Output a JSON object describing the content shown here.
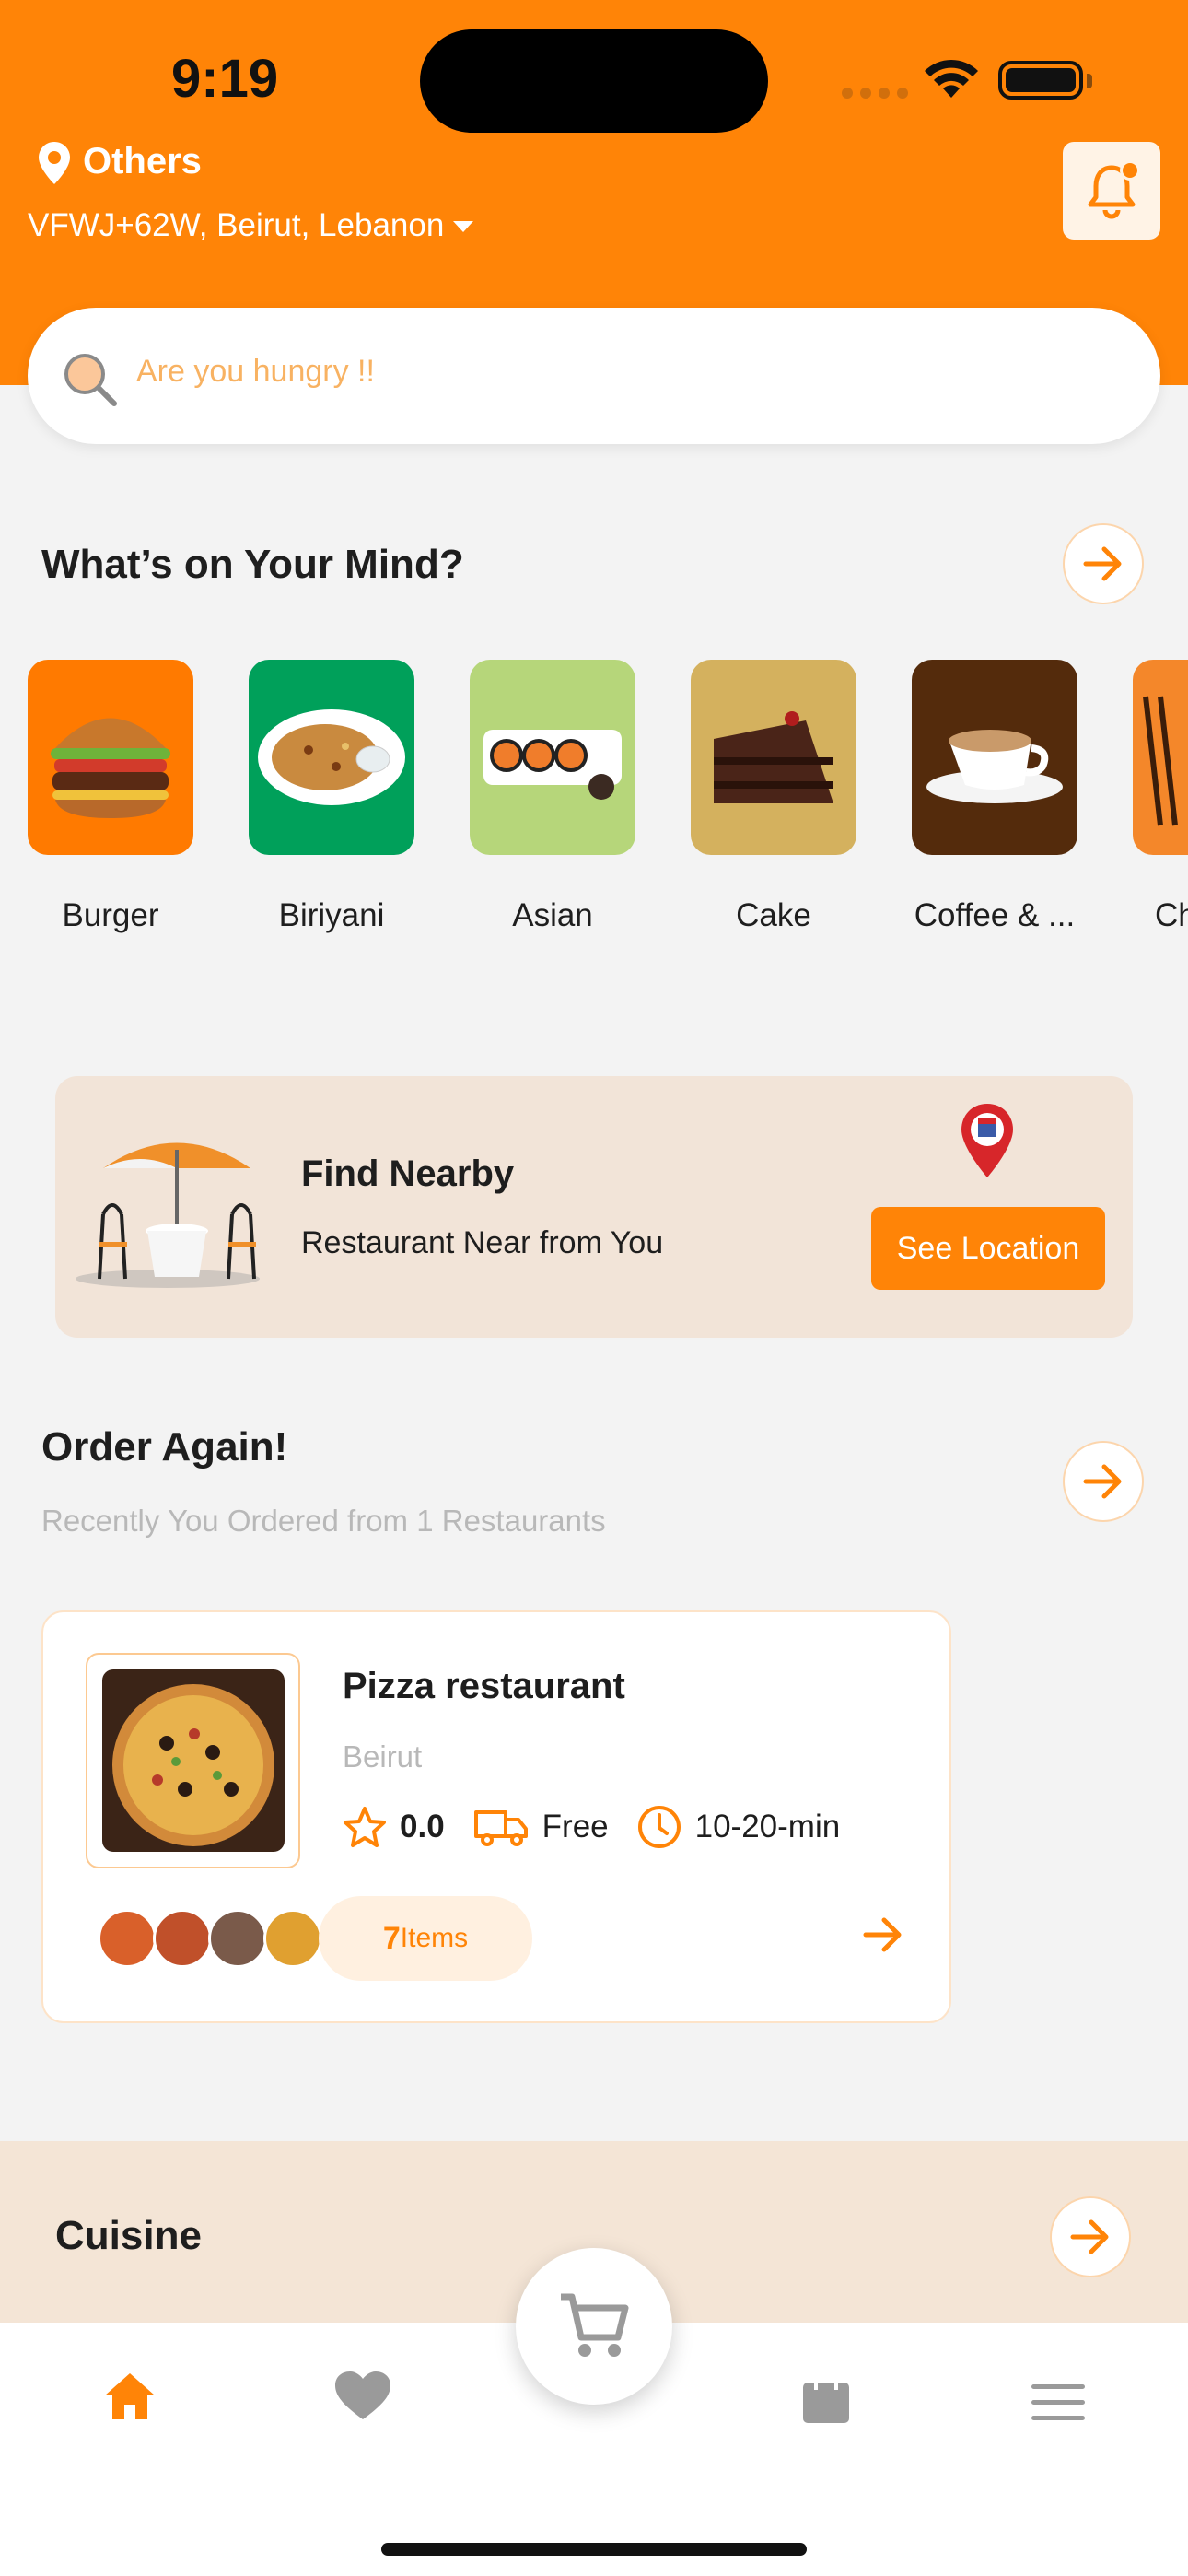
{
  "status_bar": {
    "time": "9:19"
  },
  "header": {
    "location_label": "Others",
    "address": "VFWJ+62W, Beirut, Lebanon"
  },
  "search": {
    "placeholder": "Are you hungry !!"
  },
  "mind": {
    "title": "What’s on Your Mind?",
    "categories": [
      {
        "label": "Burger"
      },
      {
        "label": "Biriyani"
      },
      {
        "label": "Asian"
      },
      {
        "label": "Cake"
      },
      {
        "label": "Coffee & ..."
      },
      {
        "label": "Ch"
      }
    ]
  },
  "nearby": {
    "title": "Find Nearby",
    "subtitle": "Restaurant Near from You",
    "button": "See Location"
  },
  "order_again": {
    "title": "Order Again!",
    "subtitle": "Recently You Ordered from 1 Restaurants",
    "restaurant": {
      "name": "Pizza restaurant",
      "city": "Beirut",
      "rating": "0.0",
      "delivery": "Free",
      "time": "10-20-min",
      "items_count": "7",
      "items_label": "Items"
    }
  },
  "cuisine": {
    "title": "Cuisine"
  },
  "colors": {
    "accent": "#ff8407",
    "background": "#f3f3f3"
  },
  "nav": {
    "items": [
      "home-icon",
      "heart-icon",
      "cart-icon",
      "bag-icon",
      "menu-icon"
    ]
  }
}
